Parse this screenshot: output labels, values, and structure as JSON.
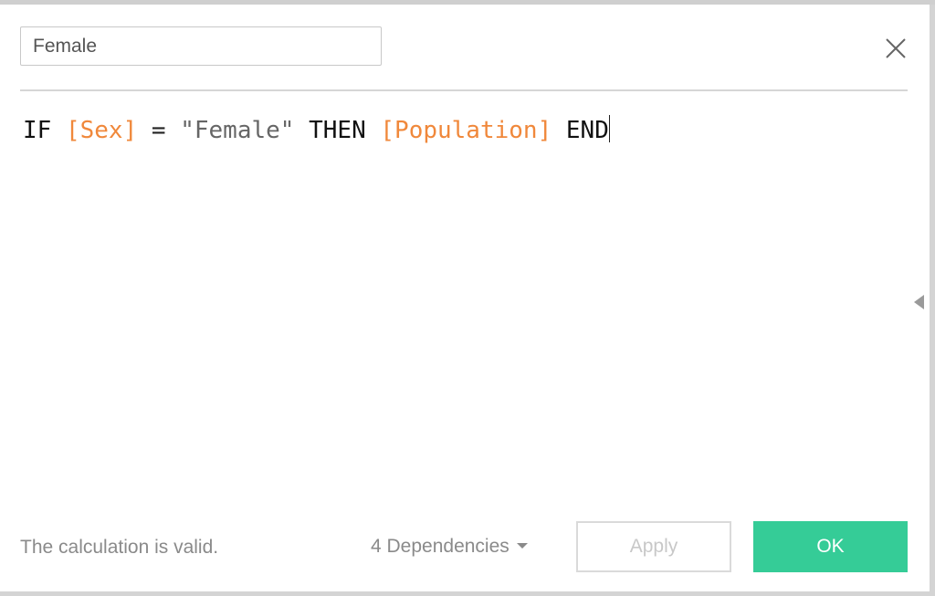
{
  "calc": {
    "name": "Female",
    "formula": {
      "if": "IF",
      "field1": "[Sex]",
      "op": "=",
      "string": "\"Female\"",
      "then": "THEN",
      "field2": "[Population]",
      "end": "END"
    }
  },
  "footer": {
    "status": "The calculation is valid.",
    "dependencies": "4 Dependencies",
    "apply_label": "Apply",
    "ok_label": "OK"
  },
  "colors": {
    "field": "#f0883b",
    "ok_button": "#35cc97"
  },
  "icons": {
    "close": "close-icon",
    "dependencies": "caret-down-icon",
    "panel": "collapse-left-icon"
  }
}
